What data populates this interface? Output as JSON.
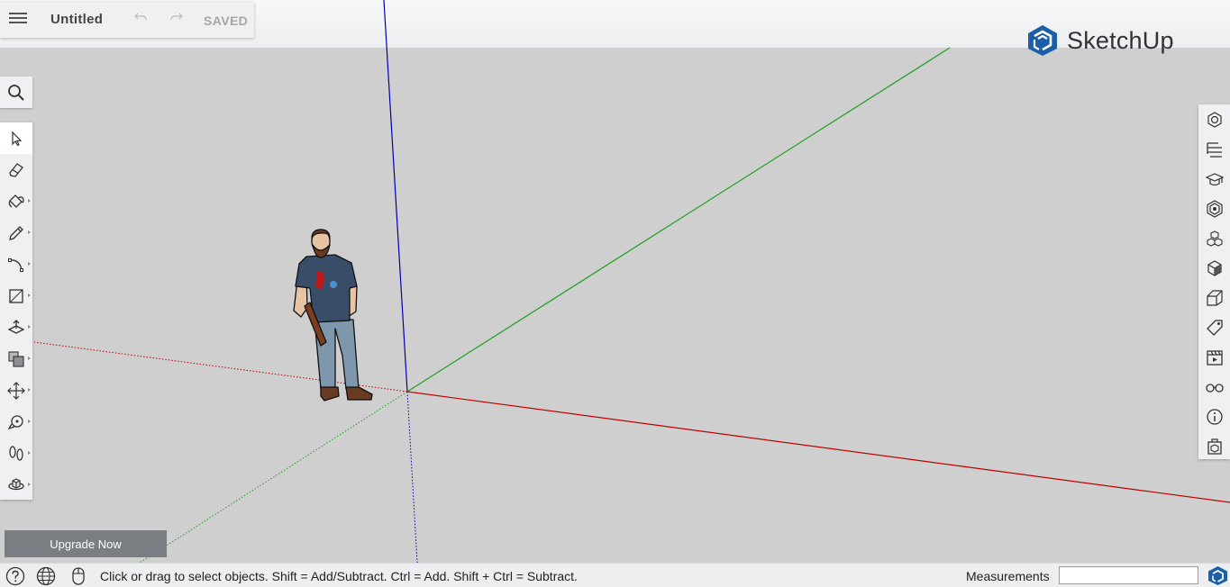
{
  "app": {
    "brand_name": "SketchUp",
    "brand_color": "#1b5fa8"
  },
  "title_panel": {
    "document_title": "Untitled",
    "save_status": "SAVED",
    "menu_icon": "hamburger-menu-icon",
    "undo_icon": "undo-icon",
    "redo_icon": "redo-icon"
  },
  "search": {
    "icon": "search-icon"
  },
  "left_toolbar": {
    "tools": [
      {
        "name": "select-tool",
        "icon": "arrow-cursor-icon",
        "active": true,
        "has_flyout": false
      },
      {
        "name": "eraser-tool",
        "icon": "eraser-icon",
        "has_flyout": false
      },
      {
        "name": "paint-bucket-tool",
        "icon": "paint-bucket-icon",
        "has_flyout": true
      },
      {
        "name": "line-tool",
        "icon": "pencil-icon",
        "has_flyout": true
      },
      {
        "name": "arc-tool",
        "icon": "arc-icon",
        "has_flyout": true
      },
      {
        "name": "rectangle-tool",
        "icon": "rectangle-icon",
        "has_flyout": true
      },
      {
        "name": "push-pull-tool",
        "icon": "push-pull-icon",
        "has_flyout": true
      },
      {
        "name": "offset-tool",
        "icon": "offset-icon",
        "has_flyout": true
      },
      {
        "name": "move-tool",
        "icon": "move-arrows-icon",
        "has_flyout": true
      },
      {
        "name": "tape-measure-tool",
        "icon": "tape-measure-icon",
        "has_flyout": true
      },
      {
        "name": "walk-tool",
        "icon": "footprints-icon",
        "has_flyout": true
      },
      {
        "name": "orbit-tool",
        "icon": "orbit-icon",
        "has_flyout": true
      }
    ]
  },
  "right_toolbar": {
    "panels": [
      {
        "name": "entity-info-panel",
        "icon": "entity-info-icon"
      },
      {
        "name": "outliner-panel",
        "icon": "outliner-icon"
      },
      {
        "name": "instructor-panel",
        "icon": "graduation-cap-icon"
      },
      {
        "name": "materials-panel",
        "icon": "materials-icon"
      },
      {
        "name": "components-panel",
        "icon": "components-icon"
      },
      {
        "name": "styles-panel",
        "icon": "styles-cube-icon"
      },
      {
        "name": "layers-panel",
        "icon": "layers-icon"
      },
      {
        "name": "tags-panel",
        "icon": "tag-icon"
      },
      {
        "name": "scenes-panel",
        "icon": "clapperboard-icon"
      },
      {
        "name": "display-panel",
        "icon": "glasses-icon"
      },
      {
        "name": "info-panel",
        "icon": "info-icon"
      },
      {
        "name": "extension-panel",
        "icon": "extension-icon"
      }
    ]
  },
  "canvas": {
    "background_color": "#cfcfcf",
    "axis_colors": {
      "red": "#c00000",
      "green": "#1ea01e",
      "blue": "#0000b0"
    }
  },
  "upgrade": {
    "label": "Upgrade Now"
  },
  "status_bar": {
    "help_icon": "help-circle-icon",
    "geo_icon": "globe-icon",
    "mouse_icon": "mouse-icon",
    "hint_text": "Click or drag to select objects. Shift = Add/Subtract. Ctrl = Add. Shift + Ctrl = Subtract.",
    "measurements_label": "Measurements",
    "measurements_value": "",
    "logo_icon": "sketchup-logo-icon"
  }
}
